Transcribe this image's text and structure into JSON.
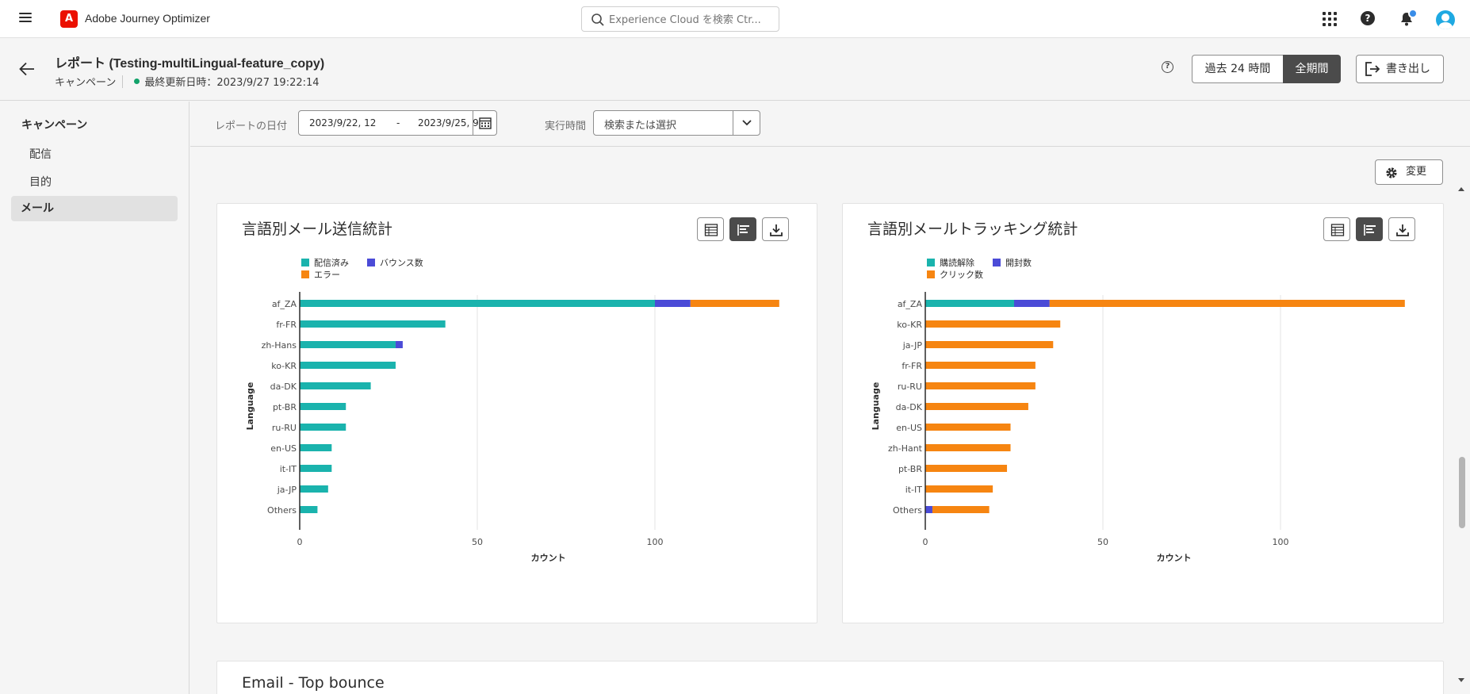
{
  "shell": {
    "app_name": "Adobe Journey Optimizer",
    "logo_letter": "A",
    "search_placeholder": "Experience Cloud を検索 Ctr...",
    "help_glyph": "?"
  },
  "header": {
    "title": "レポート (Testing-multiLingual-feature_copy)",
    "type_label": "キャンペーン",
    "last_updated": "最終更新日時：2023/9/27 19:22:14",
    "help_glyph": "?",
    "range_24h": "過去 24 時間",
    "range_all": "全期間",
    "export_label": "書き出し"
  },
  "sidebar": {
    "heading": "キャンペーン",
    "items": [
      {
        "label": "配信"
      },
      {
        "label": "目的"
      },
      {
        "label": "メール",
        "active": true
      }
    ]
  },
  "filters": {
    "date_label": "レポートの日付",
    "date_start": "2023/9/22,  12",
    "date_sep": "-",
    "date_end": "2023/9/25,  9",
    "time_label": "実行時間",
    "time_placeholder": "検索または選択"
  },
  "content": {
    "change_label": "変更",
    "second_card_title": "Email - Top bounce"
  },
  "colors": {
    "teal": "#1ab3ad",
    "indigo": "#4b4bd7",
    "orange": "#f68511",
    "accent_dark": "#4b4b4b"
  },
  "chart_data": [
    {
      "type": "bar",
      "orientation": "horizontal",
      "stacked": true,
      "title": "言語別メール送信統計",
      "xlabel": "カウント",
      "ylabel": "Language",
      "xlim": [
        0,
        135
      ],
      "x_ticks": [
        0,
        50,
        100
      ],
      "grid": true,
      "legend_position": "top-left",
      "categories": [
        "af_ZA",
        "fr-FR",
        "zh-Hans",
        "ko-KR",
        "da-DK",
        "pt-BR",
        "ru-RU",
        "en-US",
        "it-IT",
        "ja-JP",
        "Others"
      ],
      "series": [
        {
          "name": "配信済み",
          "color": "#1ab3ad",
          "values": [
            100,
            41,
            27,
            27,
            20,
            13,
            13,
            9,
            9,
            8,
            5
          ]
        },
        {
          "name": "バウンス数",
          "color": "#4b4bd7",
          "values": [
            10,
            0,
            2,
            0,
            0,
            0,
            0,
            0,
            0,
            0,
            0
          ]
        },
        {
          "name": "エラー",
          "color": "#f68511",
          "values": [
            25,
            0,
            0,
            0,
            0,
            0,
            0,
            0,
            0,
            0,
            0
          ]
        }
      ]
    },
    {
      "type": "bar",
      "orientation": "horizontal",
      "stacked": true,
      "title": "言語別メールトラッキング統計",
      "xlabel": "カウント",
      "ylabel": "Language",
      "xlim": [
        0,
        135
      ],
      "x_ticks": [
        0,
        50,
        100
      ],
      "grid": true,
      "legend_position": "top-left",
      "categories": [
        "af_ZA",
        "ko-KR",
        "ja-JP",
        "fr-FR",
        "ru-RU",
        "da-DK",
        "en-US",
        "zh-Hant",
        "pt-BR",
        "it-IT",
        "Others"
      ],
      "series": [
        {
          "name": "購読解除",
          "color": "#1ab3ad",
          "values": [
            25,
            0,
            0,
            0,
            0,
            0,
            0,
            0,
            0,
            0,
            0
          ]
        },
        {
          "name": "開封数",
          "color": "#4b4bd7",
          "values": [
            10,
            0,
            0,
            0,
            0,
            0,
            0,
            0,
            0,
            0,
            2
          ]
        },
        {
          "name": "クリック数",
          "color": "#f68511",
          "values": [
            100,
            38,
            36,
            31,
            31,
            29,
            24,
            24,
            23,
            19,
            16
          ]
        }
      ]
    }
  ]
}
